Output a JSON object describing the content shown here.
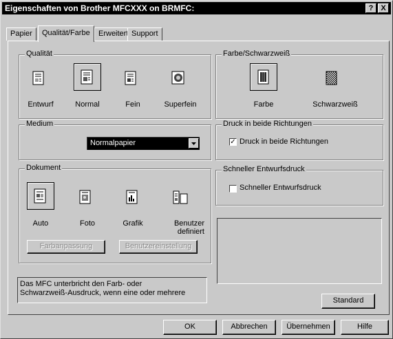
{
  "window": {
    "title": "Eigenschaften von Brother MFCXXX on BRMFC:",
    "help_button": "?",
    "close_button": "X"
  },
  "tabs": [
    {
      "label": "Papier",
      "active": false
    },
    {
      "label": "Qualität/Farbe",
      "active": true
    },
    {
      "label": "Erweitert",
      "active": false
    },
    {
      "label": "Support",
      "active": false
    }
  ],
  "qualitaet": {
    "title": "Qualität",
    "options": [
      {
        "label": "Entwurf",
        "icon": "draft-quality-icon",
        "selected": false
      },
      {
        "label": "Normal",
        "icon": "normal-quality-icon",
        "selected": true
      },
      {
        "label": "Fein",
        "icon": "fine-quality-icon",
        "selected": false
      },
      {
        "label": "Superfein",
        "icon": "superfine-quality-icon",
        "selected": false
      }
    ]
  },
  "farbe": {
    "title": "Farbe/Schwarzweiß",
    "options": [
      {
        "label": "Farbe",
        "icon": "color-icon",
        "selected": true
      },
      {
        "label": "Schwarzweiß",
        "icon": "monochrome-icon",
        "selected": false
      }
    ]
  },
  "medium": {
    "title": "Medium",
    "selected": "Normalpapier"
  },
  "duplex": {
    "title": "Druck in beide Richtungen",
    "checkbox_label": "Druck in beide Richtungen",
    "checked": true
  },
  "schnell": {
    "title": "Schneller Entwurfsdruck",
    "checkbox_label": "Schneller Entwurfsdruck",
    "checked": false
  },
  "dokument": {
    "title": "Dokument",
    "options": [
      {
        "label": "Auto",
        "icon": "auto-document-icon",
        "selected": true
      },
      {
        "label": "Foto",
        "icon": "photo-document-icon",
        "selected": false
      },
      {
        "label": "Grafik",
        "icon": "graphic-document-icon",
        "selected": false
      },
      {
        "label": "Benutzer\ndefiniert",
        "icon": "custom-document-icon",
        "selected": false
      }
    ],
    "farbanpassung_button": "Farbanpassung",
    "benutzereinstellung_button": "Benutzereinstellung"
  },
  "info_text": "Das MFC unterbricht den Farb- oder\nSchwarzweiß-Ausdruck, wenn eine oder mehrere",
  "standard_button": "Standard",
  "footer": {
    "ok": "OK",
    "abbrechen": "Abbrechen",
    "uebernehmen": "Übernehmen",
    "hilfe": "Hilfe"
  }
}
